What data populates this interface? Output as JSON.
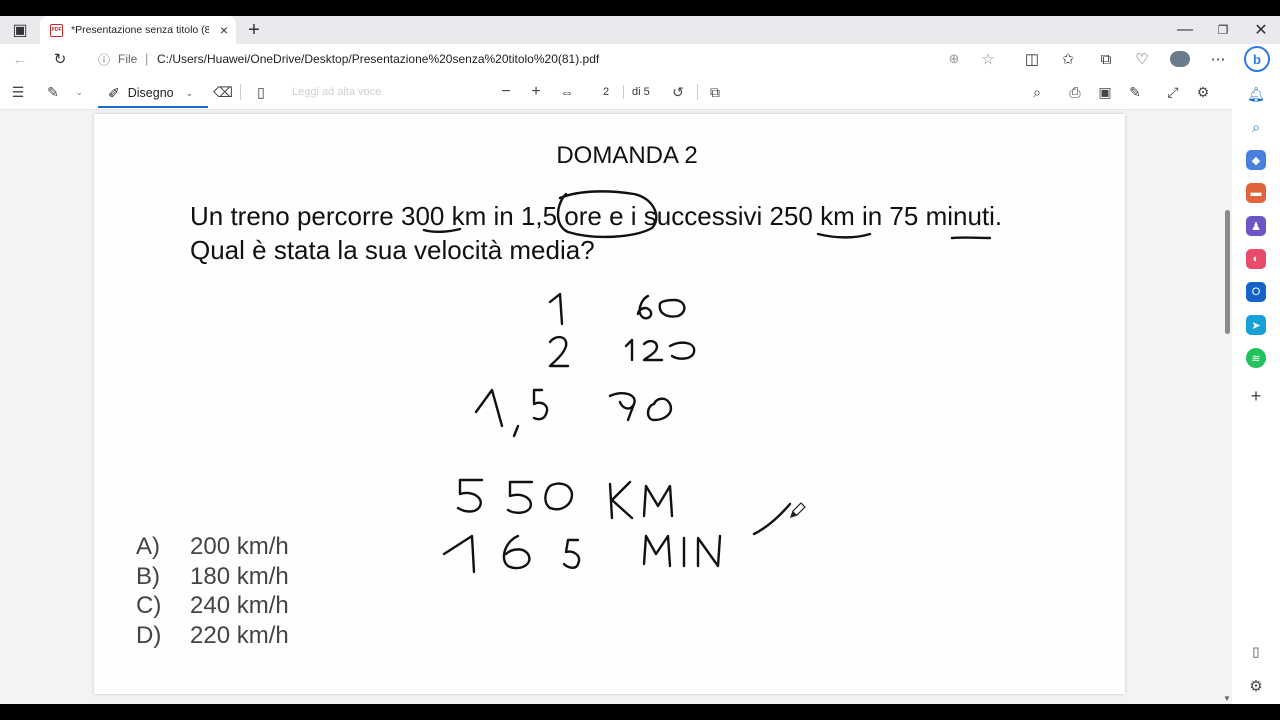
{
  "browser": {
    "tab_title": "*Presentazione senza titolo (81).pdf",
    "tab_favicon": "PDF",
    "address_prefix": "File",
    "address_url": "C:/Users/Huawei/OneDrive/Desktop/Presentazione%20senza%20titolo%20(81).pdf",
    "copilot_label": "b"
  },
  "pdf_toolbar": {
    "draw_label": "Disegno",
    "read_aloud_label": "Leggi ad alta voce",
    "page_number": "2",
    "page_of": "di 5"
  },
  "document": {
    "heading": "DOMANDA 2",
    "question": "Un treno percorre 300 km in 1,5 ore e i successivi 250 km in 75 minuti. Qual è stata la sua velocità media?",
    "answers": [
      {
        "letter": "A)",
        "text": "200 km/h"
      },
      {
        "letter": "B)",
        "text": "180 km/h"
      },
      {
        "letter": "C)",
        "text": "240 km/h"
      },
      {
        "letter": "D)",
        "text": "220 km/h"
      }
    ],
    "handwriting": [
      "1",
      "60",
      "2",
      "120",
      "1,5",
      "90",
      "550 KM",
      "165 MIN"
    ]
  },
  "colors": {
    "accent": "#1a6dd1",
    "ink": "#111111"
  }
}
